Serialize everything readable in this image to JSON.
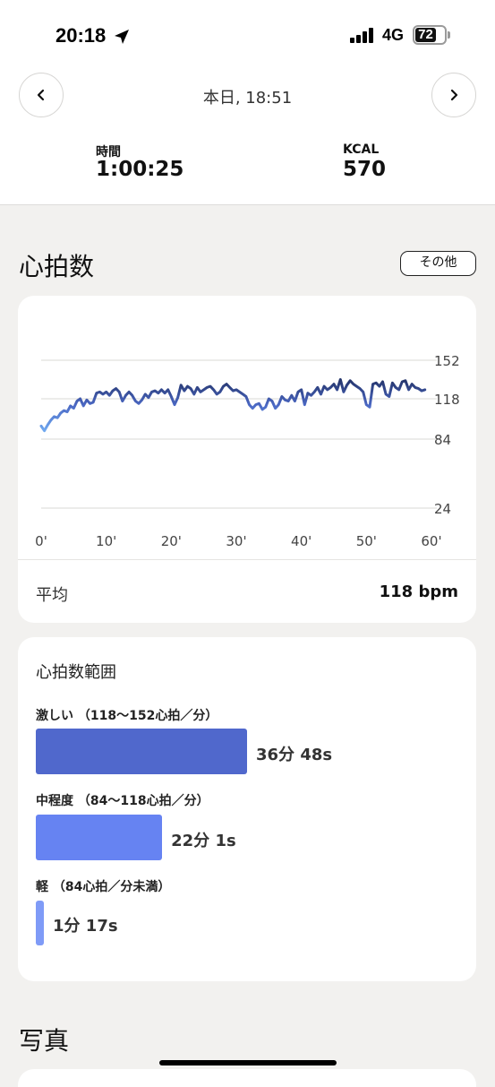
{
  "status_bar": {
    "time": "20:18",
    "network": "4G",
    "battery": "72"
  },
  "header": {
    "title": "本日, 18:51"
  },
  "stats": [
    {
      "label": "時間",
      "value": "1:00:25"
    },
    {
      "label": "KCAL",
      "value": "570"
    }
  ],
  "heart_rate": {
    "section_title": "心拍数",
    "more_button": "その他",
    "average_label": "平均",
    "average_value": "118 bpm"
  },
  "chart_data": {
    "type": "line",
    "x_ticks": [
      "0'",
      "10'",
      "20'",
      "30'",
      "40'",
      "50'",
      "60'"
    ],
    "y_ticks": [
      "24",
      "84",
      "118",
      "152"
    ],
    "xlim": [
      0,
      60
    ],
    "ylim": [
      24,
      152
    ],
    "grid": true,
    "line_gradient": [
      "#6fa8ef",
      "#4b68c4",
      "#24346a"
    ],
    "x": [
      0,
      0.5,
      1,
      1.5,
      2,
      2.5,
      3,
      3.5,
      4,
      4.5,
      5,
      5.5,
      6,
      6.5,
      7,
      7.5,
      8,
      8.5,
      9,
      9.5,
      10,
      10.5,
      11,
      11.5,
      12,
      12.5,
      13,
      13.5,
      14,
      14.5,
      15,
      15.5,
      16,
      16.5,
      17,
      17.5,
      18,
      18.5,
      19,
      19.5,
      20,
      20.5,
      21,
      21.5,
      22,
      22.5,
      23,
      23.5,
      24,
      24.5,
      25,
      25.5,
      26,
      26.5,
      27,
      27.5,
      28,
      28.5,
      29,
      29.5,
      30,
      30.5,
      31,
      31.5,
      32,
      32.5,
      33,
      33.5,
      34,
      34.5,
      35,
      35.5,
      36,
      36.5,
      37,
      37.5,
      38,
      38.5,
      39,
      39.5,
      40,
      40.5,
      41,
      41.5,
      42,
      42.5,
      43,
      43.5,
      44,
      44.5,
      45,
      45.5,
      46,
      46.5,
      47,
      47.5,
      48,
      48.5,
      49,
      49.5,
      50,
      50.5,
      51,
      51.5,
      52,
      52.5,
      53,
      53.5,
      54,
      54.5,
      55,
      55.5,
      56,
      56.5,
      57,
      57.5,
      58,
      58.5,
      59,
      59.5,
      60
    ],
    "values": [
      95,
      91,
      96,
      100,
      103,
      102,
      106,
      108,
      107,
      112,
      110,
      116,
      118,
      112,
      117,
      114,
      115,
      123,
      124,
      122,
      124,
      121,
      125,
      127,
      124,
      116,
      121,
      124,
      121,
      116,
      114,
      117,
      122,
      119,
      124,
      125,
      123,
      126,
      123,
      126,
      120,
      113,
      119,
      130,
      125,
      129,
      127,
      122,
      128,
      124,
      126,
      128,
      129,
      126,
      122,
      124,
      129,
      131,
      128,
      125,
      126,
      124,
      122,
      120,
      113,
      110,
      113,
      114,
      109,
      111,
      118,
      116,
      110,
      113,
      120,
      117,
      116,
      121,
      116,
      124,
      126,
      113,
      123,
      121,
      124,
      128,
      122,
      129,
      126,
      128,
      131,
      126,
      135,
      124,
      130,
      134,
      131,
      129,
      127,
      124,
      113,
      111,
      131,
      132,
      129,
      133,
      122,
      120,
      132,
      128,
      126,
      133,
      134,
      126,
      131,
      128,
      127,
      125,
      126
    ]
  },
  "zones": {
    "title": "心拍数範囲",
    "items": [
      {
        "label": "激しい （118〜152心拍／分）",
        "value": "36分 48s",
        "fraction": 1.0,
        "color": "#5068cc"
      },
      {
        "label": "中程度 （84〜118心拍／分）",
        "value": "22分 1s",
        "fraction": 0.598,
        "color": "#6683f2"
      },
      {
        "label": "軽 （84心拍／分未満）",
        "value": "1分 17s",
        "fraction": 0.035,
        "color": "#7f9bf7"
      }
    ]
  },
  "photos": {
    "title": "写真"
  }
}
